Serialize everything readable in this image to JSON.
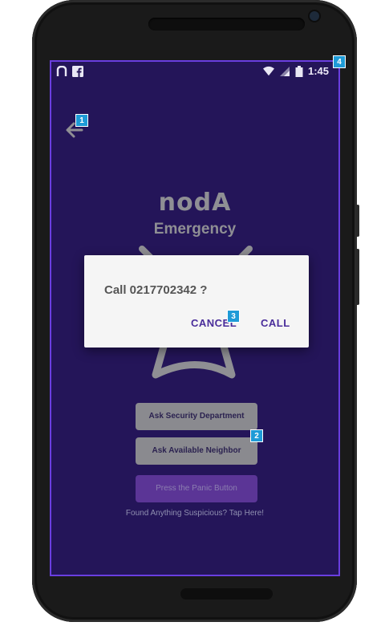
{
  "status_bar": {
    "time": "1:45",
    "left_icons": [
      "noda-icon",
      "facebook-icon"
    ],
    "right_icons": [
      "wifi-icon",
      "signal-icon",
      "battery-icon"
    ]
  },
  "annotations": {
    "back": "1",
    "neighbor": "2",
    "cancel": "3",
    "screen": "4"
  },
  "logo": {
    "brand": "nodA",
    "subtitle": "Emergency"
  },
  "buttons": {
    "security": "Ask Security Department",
    "neighbor": "Ask Available Neighbor",
    "panic": "Press the Panic Button"
  },
  "footer_text": "Found Anything Suspicious? Tap Here!",
  "dialog": {
    "message": "Call 0217702342 ?",
    "cancel": "CANCEL",
    "call": "CALL"
  },
  "colors": {
    "screen_bg": "#241559",
    "accent": "#4a2d9a",
    "badge": "#1e9bd7"
  }
}
